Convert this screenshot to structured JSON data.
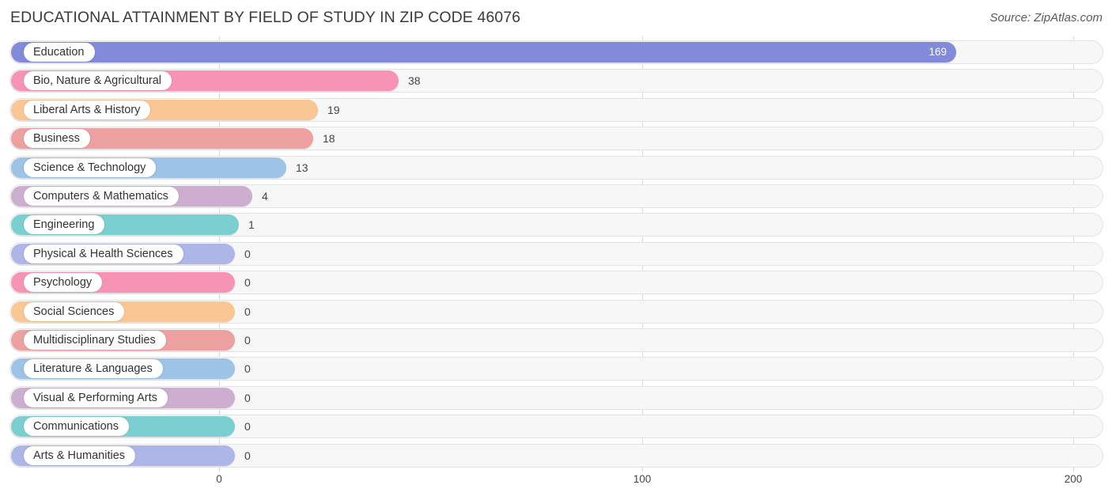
{
  "header": {
    "title": "EDUCATIONAL ATTAINMENT BY FIELD OF STUDY IN ZIP CODE 46076",
    "source": "Source: ZipAtlas.com"
  },
  "chart_data": {
    "type": "bar",
    "orientation": "horizontal",
    "title": "EDUCATIONAL ATTAINMENT BY FIELD OF STUDY IN ZIP CODE 46076",
    "xlabel": "",
    "ylabel": "",
    "xlim": [
      0,
      200
    ],
    "xticks": [
      0,
      100,
      200
    ],
    "xtick_labels": [
      "0",
      "100",
      "200"
    ],
    "grid": true,
    "legend": "none",
    "categories": [
      "Education",
      "Bio, Nature & Agricultural",
      "Liberal Arts & History",
      "Business",
      "Science & Technology",
      "Computers & Mathematics",
      "Engineering",
      "Physical & Health Sciences",
      "Psychology",
      "Social Sciences",
      "Multidisciplinary Studies",
      "Literature & Languages",
      "Visual & Performing Arts",
      "Communications",
      "Arts & Humanities"
    ],
    "values": [
      169,
      38,
      19,
      18,
      13,
      4,
      1,
      0,
      0,
      0,
      0,
      0,
      0,
      0,
      0
    ],
    "value_labels": [
      "169",
      "38",
      "19",
      "18",
      "13",
      "4",
      "1",
      "0",
      "0",
      "0",
      "0",
      "0",
      "0",
      "0",
      "0"
    ],
    "colors": [
      "#818bd9",
      "#f793b4",
      "#fac693",
      "#eda0a0",
      "#9dc3e6",
      "#ceaed0",
      "#7ccfd0",
      "#aeb6e8",
      "#f793b4",
      "#fac693",
      "#eda0a0",
      "#9dc3e6",
      "#ceaed0",
      "#7ccfd0",
      "#aeb6e8"
    ],
    "bar_pixel_widths": [
      1195,
      490,
      388,
      382,
      348,
      305,
      288,
      283,
      283,
      283,
      283,
      283,
      283,
      283,
      283
    ],
    "value_inside": [
      true,
      false,
      false,
      false,
      false,
      false,
      false,
      false,
      false,
      false,
      false,
      false,
      false,
      false,
      false
    ]
  },
  "axis": {
    "tick_x": [
      277,
      812,
      1357
    ]
  },
  "gridlines_x": [
    277,
    812,
    1357
  ]
}
